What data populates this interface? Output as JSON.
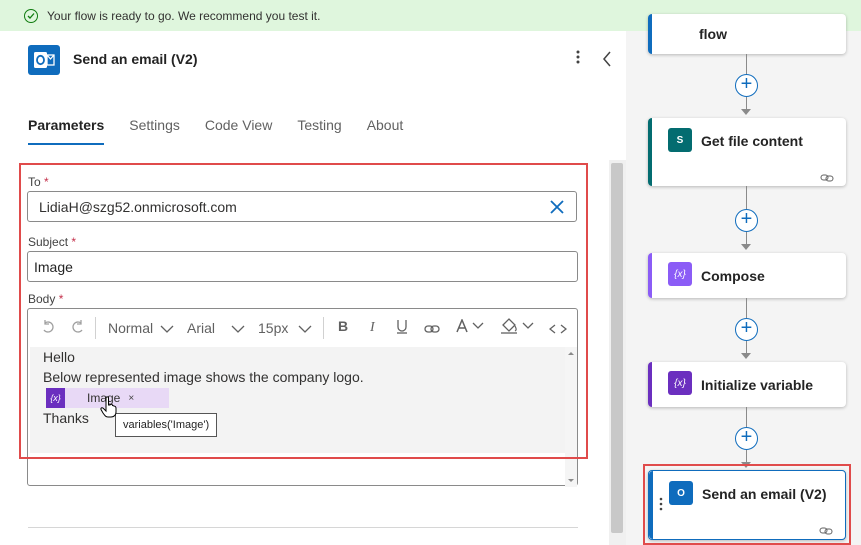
{
  "banner": {
    "message": "Your flow is ready to go. We recommend you test it."
  },
  "action_panel": {
    "title": "Send an email (V2)",
    "tabs": [
      {
        "label": "Parameters",
        "active": true
      },
      {
        "label": "Settings",
        "active": false
      },
      {
        "label": "Code View",
        "active": false
      },
      {
        "label": "Testing",
        "active": false
      },
      {
        "label": "About",
        "active": false
      }
    ],
    "to": {
      "label": "To",
      "required_mark": "*",
      "value": "LidiaH@szg52.onmicrosoft.com"
    },
    "subject": {
      "label": "Subject",
      "required_mark": "*",
      "value": "Image"
    },
    "body": {
      "label": "Body",
      "required_mark": "*",
      "toolbar": {
        "style": "Normal",
        "font": "Arial",
        "size": "15px"
      },
      "lines": [
        "Hello",
        "Below represented image shows the company logo.",
        "Thanks"
      ],
      "token": {
        "icon_text": "{x}",
        "label": "Image",
        "remove": "×"
      },
      "tooltip": "variables('Image')"
    }
  },
  "flow": {
    "cards": [
      {
        "title": "flow",
        "color": "#0f6cbd"
      },
      {
        "title": "Get file content",
        "icon_text": "S",
        "color": "#036c70"
      },
      {
        "title": "Compose",
        "icon_text": "{x}",
        "color": "#8b5cf6"
      },
      {
        "title": "Initialize variable",
        "icon_text": "{x}",
        "color": "#6b2fbf"
      },
      {
        "title": "Send an email (V2)",
        "icon_text": "O",
        "color": "#0f6cbd"
      }
    ],
    "add_step": "+"
  },
  "colors": {
    "accent": "#0f6cbd",
    "highlight": "#e04b4b",
    "success_bg": "#dff6dd"
  }
}
